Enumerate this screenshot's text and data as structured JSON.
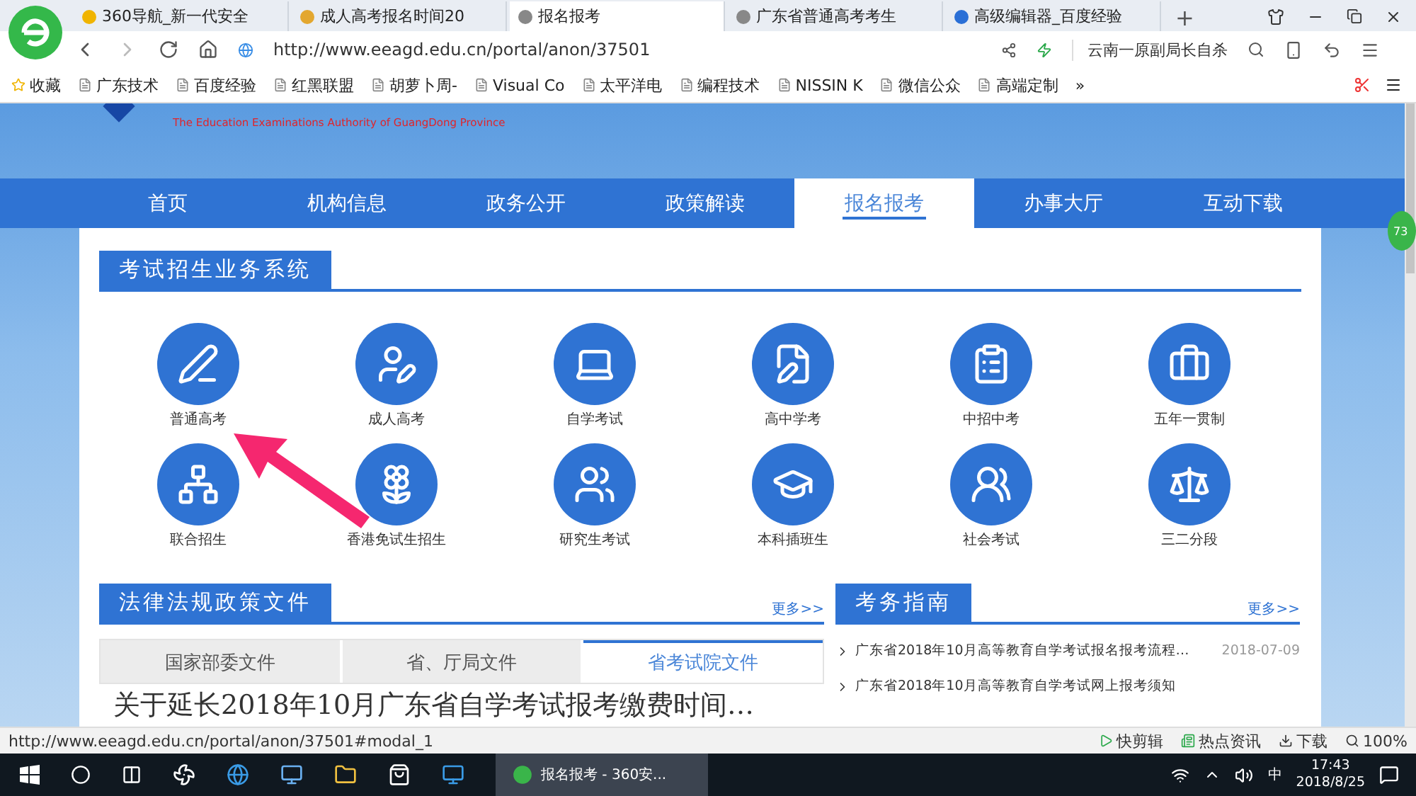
{
  "browser": {
    "tabs": [
      {
        "title": "360导航_新一代安全",
        "selected": false
      },
      {
        "title": "成人高考报名时间20",
        "selected": false
      },
      {
        "title": "报名报考",
        "selected": true
      },
      {
        "title": "广东省普通高考考生",
        "selected": false
      },
      {
        "title": "高级编辑器_百度经验",
        "selected": false
      }
    ],
    "new_tab": "+",
    "url": "http://www.eeagd.edu.cn/portal/anon/37501",
    "search_text": "云南一原副局长自杀",
    "bookmarks": [
      "收藏",
      "广东技术",
      "百度经验",
      "红黑联盟",
      "胡萝卜周-",
      "Visual Co",
      "太平洋电",
      "编程技术",
      "NISSIN K",
      "微信公众",
      "高端定制"
    ],
    "more_bookmarks": "»"
  },
  "page": {
    "subtitle": "The Education Examinations Authority of GuangDong Province",
    "nav": [
      {
        "label": "首页",
        "selected": false
      },
      {
        "label": "机构信息",
        "selected": false
      },
      {
        "label": "政务公开",
        "selected": false
      },
      {
        "label": "政策解读",
        "selected": false
      },
      {
        "label": "报名报考",
        "selected": true
      },
      {
        "label": "办事大厅",
        "selected": false
      },
      {
        "label": "互动下载",
        "selected": false
      }
    ],
    "side_badge": "73",
    "system_title": "考试招生业务系统",
    "services": [
      "普通高考",
      "成人高考",
      "自学考试",
      "高中学考",
      "中招中考",
      "五年一贯制",
      "联合招生",
      "香港免试生招生",
      "研究生考试",
      "本科插班生",
      "社会考试",
      "三二分段"
    ],
    "laws": {
      "title": "法律法规政策文件",
      "more": "更多>>",
      "tabs": [
        {
          "label": "国家部委文件",
          "selected": false
        },
        {
          "label": "省、厅局文件",
          "selected": false
        },
        {
          "label": "省考试院文件",
          "selected": true
        }
      ],
      "headline": "关于延长2018年10月广东省自学考试报考缴费时间…"
    },
    "guide": {
      "title": "考务指南",
      "more": "更多>>",
      "items": [
        {
          "text": "广东省2018年10月高等教育自学考试报名报考流程…",
          "date": "2018-07-09"
        },
        {
          "text": "广东省2018年10月高等教育自学考试网上报考须知"
        }
      ]
    }
  },
  "status_bar": {
    "url": "http://www.eeagd.edu.cn/portal/anon/37501#modal_1",
    "items": [
      "快剪辑",
      "热点资讯",
      "下载"
    ],
    "zoom": "100%"
  },
  "taskbar": {
    "app": "报名报考 - 360安...",
    "ime": "中",
    "time": "17:43",
    "date": "2018/8/25"
  }
}
